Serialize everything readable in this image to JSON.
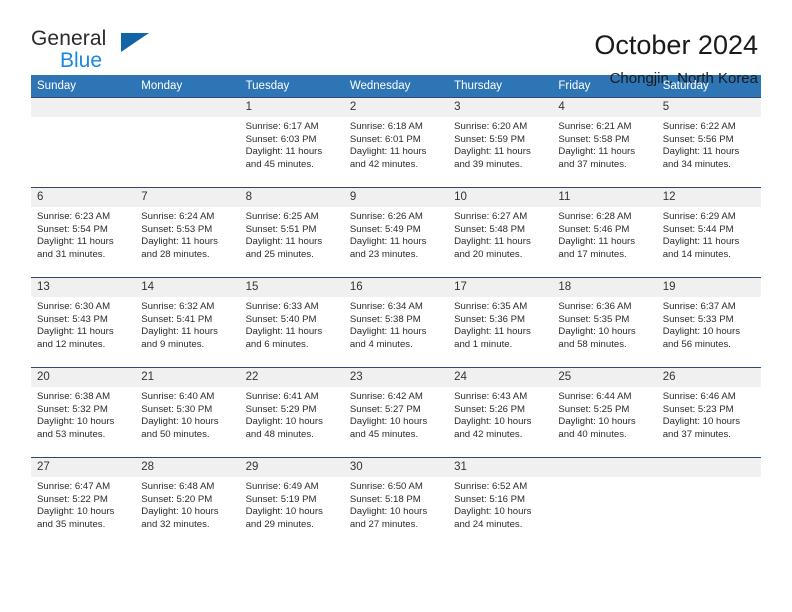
{
  "logo": {
    "word_top": "General",
    "word_bottom": "Blue",
    "triangle_icon": "blue-triangle-icon",
    "color_dark": "#2b2b2b",
    "color_blue": "#1c87df",
    "color_triangle": "#1363a8"
  },
  "header": {
    "title": "October 2024",
    "subtitle": "Chongjin, North Korea"
  },
  "theme": {
    "header_row_bg": "#2e75b6",
    "header_row_text": "#ffffff",
    "daynum_bg": "#f0f0f0",
    "row_border": "#2e4a6b",
    "body_text": "#2b2b2b"
  },
  "weekdays": [
    "Sunday",
    "Monday",
    "Tuesday",
    "Wednesday",
    "Thursday",
    "Friday",
    "Saturday"
  ],
  "weeks": [
    [
      {
        "day": "",
        "lines": []
      },
      {
        "day": "",
        "lines": []
      },
      {
        "day": "1",
        "lines": [
          "Sunrise: 6:17 AM",
          "Sunset: 6:03 PM",
          "Daylight: 11 hours",
          "and 45 minutes."
        ]
      },
      {
        "day": "2",
        "lines": [
          "Sunrise: 6:18 AM",
          "Sunset: 6:01 PM",
          "Daylight: 11 hours",
          "and 42 minutes."
        ]
      },
      {
        "day": "3",
        "lines": [
          "Sunrise: 6:20 AM",
          "Sunset: 5:59 PM",
          "Daylight: 11 hours",
          "and 39 minutes."
        ]
      },
      {
        "day": "4",
        "lines": [
          "Sunrise: 6:21 AM",
          "Sunset: 5:58 PM",
          "Daylight: 11 hours",
          "and 37 minutes."
        ]
      },
      {
        "day": "5",
        "lines": [
          "Sunrise: 6:22 AM",
          "Sunset: 5:56 PM",
          "Daylight: 11 hours",
          "and 34 minutes."
        ]
      }
    ],
    [
      {
        "day": "6",
        "lines": [
          "Sunrise: 6:23 AM",
          "Sunset: 5:54 PM",
          "Daylight: 11 hours",
          "and 31 minutes."
        ]
      },
      {
        "day": "7",
        "lines": [
          "Sunrise: 6:24 AM",
          "Sunset: 5:53 PM",
          "Daylight: 11 hours",
          "and 28 minutes."
        ]
      },
      {
        "day": "8",
        "lines": [
          "Sunrise: 6:25 AM",
          "Sunset: 5:51 PM",
          "Daylight: 11 hours",
          "and 25 minutes."
        ]
      },
      {
        "day": "9",
        "lines": [
          "Sunrise: 6:26 AM",
          "Sunset: 5:49 PM",
          "Daylight: 11 hours",
          "and 23 minutes."
        ]
      },
      {
        "day": "10",
        "lines": [
          "Sunrise: 6:27 AM",
          "Sunset: 5:48 PM",
          "Daylight: 11 hours",
          "and 20 minutes."
        ]
      },
      {
        "day": "11",
        "lines": [
          "Sunrise: 6:28 AM",
          "Sunset: 5:46 PM",
          "Daylight: 11 hours",
          "and 17 minutes."
        ]
      },
      {
        "day": "12",
        "lines": [
          "Sunrise: 6:29 AM",
          "Sunset: 5:44 PM",
          "Daylight: 11 hours",
          "and 14 minutes."
        ]
      }
    ],
    [
      {
        "day": "13",
        "lines": [
          "Sunrise: 6:30 AM",
          "Sunset: 5:43 PM",
          "Daylight: 11 hours",
          "and 12 minutes."
        ]
      },
      {
        "day": "14",
        "lines": [
          "Sunrise: 6:32 AM",
          "Sunset: 5:41 PM",
          "Daylight: 11 hours",
          "and 9 minutes."
        ]
      },
      {
        "day": "15",
        "lines": [
          "Sunrise: 6:33 AM",
          "Sunset: 5:40 PM",
          "Daylight: 11 hours",
          "and 6 minutes."
        ]
      },
      {
        "day": "16",
        "lines": [
          "Sunrise: 6:34 AM",
          "Sunset: 5:38 PM",
          "Daylight: 11 hours",
          "and 4 minutes."
        ]
      },
      {
        "day": "17",
        "lines": [
          "Sunrise: 6:35 AM",
          "Sunset: 5:36 PM",
          "Daylight: 11 hours",
          "and 1 minute."
        ]
      },
      {
        "day": "18",
        "lines": [
          "Sunrise: 6:36 AM",
          "Sunset: 5:35 PM",
          "Daylight: 10 hours",
          "and 58 minutes."
        ]
      },
      {
        "day": "19",
        "lines": [
          "Sunrise: 6:37 AM",
          "Sunset: 5:33 PM",
          "Daylight: 10 hours",
          "and 56 minutes."
        ]
      }
    ],
    [
      {
        "day": "20",
        "lines": [
          "Sunrise: 6:38 AM",
          "Sunset: 5:32 PM",
          "Daylight: 10 hours",
          "and 53 minutes."
        ]
      },
      {
        "day": "21",
        "lines": [
          "Sunrise: 6:40 AM",
          "Sunset: 5:30 PM",
          "Daylight: 10 hours",
          "and 50 minutes."
        ]
      },
      {
        "day": "22",
        "lines": [
          "Sunrise: 6:41 AM",
          "Sunset: 5:29 PM",
          "Daylight: 10 hours",
          "and 48 minutes."
        ]
      },
      {
        "day": "23",
        "lines": [
          "Sunrise: 6:42 AM",
          "Sunset: 5:27 PM",
          "Daylight: 10 hours",
          "and 45 minutes."
        ]
      },
      {
        "day": "24",
        "lines": [
          "Sunrise: 6:43 AM",
          "Sunset: 5:26 PM",
          "Daylight: 10 hours",
          "and 42 minutes."
        ]
      },
      {
        "day": "25",
        "lines": [
          "Sunrise: 6:44 AM",
          "Sunset: 5:25 PM",
          "Daylight: 10 hours",
          "and 40 minutes."
        ]
      },
      {
        "day": "26",
        "lines": [
          "Sunrise: 6:46 AM",
          "Sunset: 5:23 PM",
          "Daylight: 10 hours",
          "and 37 minutes."
        ]
      }
    ],
    [
      {
        "day": "27",
        "lines": [
          "Sunrise: 6:47 AM",
          "Sunset: 5:22 PM",
          "Daylight: 10 hours",
          "and 35 minutes."
        ]
      },
      {
        "day": "28",
        "lines": [
          "Sunrise: 6:48 AM",
          "Sunset: 5:20 PM",
          "Daylight: 10 hours",
          "and 32 minutes."
        ]
      },
      {
        "day": "29",
        "lines": [
          "Sunrise: 6:49 AM",
          "Sunset: 5:19 PM",
          "Daylight: 10 hours",
          "and 29 minutes."
        ]
      },
      {
        "day": "30",
        "lines": [
          "Sunrise: 6:50 AM",
          "Sunset: 5:18 PM",
          "Daylight: 10 hours",
          "and 27 minutes."
        ]
      },
      {
        "day": "31",
        "lines": [
          "Sunrise: 6:52 AM",
          "Sunset: 5:16 PM",
          "Daylight: 10 hours",
          "and 24 minutes."
        ]
      },
      {
        "day": "",
        "lines": []
      },
      {
        "day": "",
        "lines": []
      }
    ]
  ]
}
